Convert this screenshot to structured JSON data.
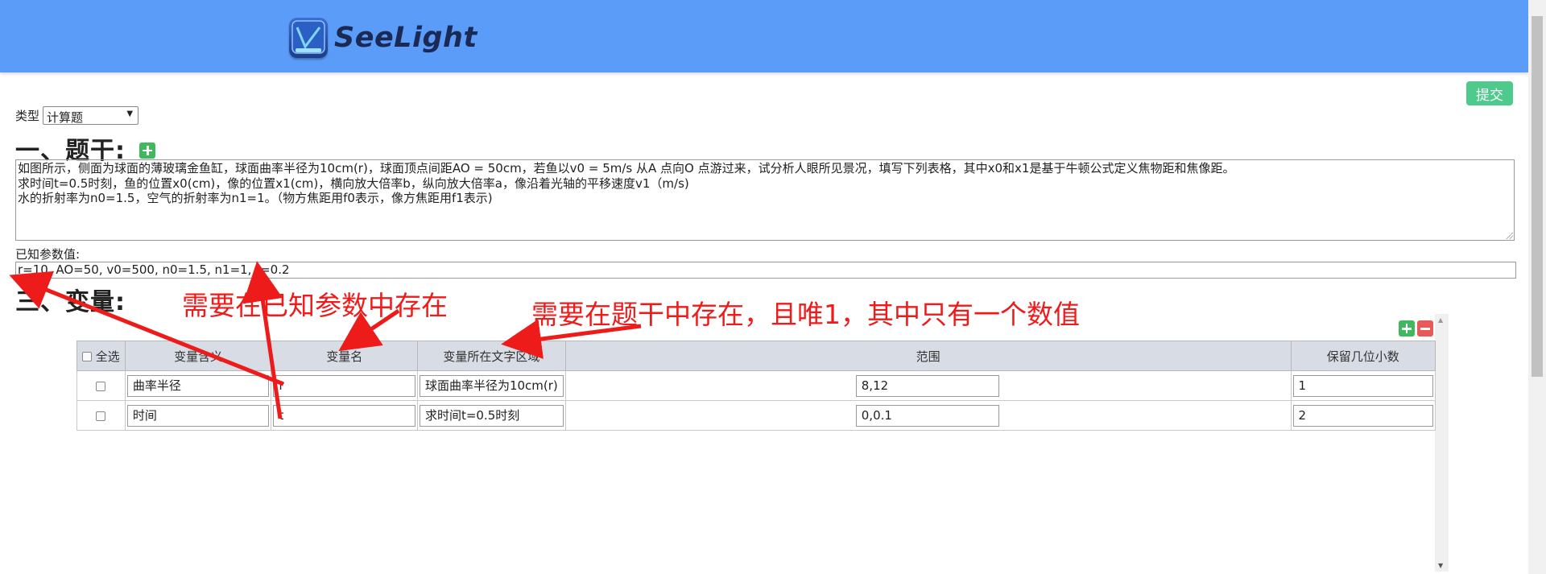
{
  "header": {
    "logo_text": "SeeLight",
    "logo_mark_text": "See Light"
  },
  "toolbar": {
    "submit_label": "提交"
  },
  "type_field": {
    "label": "类型",
    "value": "计算题"
  },
  "section_stem": {
    "title": "一、题干:"
  },
  "stem_text": [
    "如图所示，侧面为球面的薄玻璃金鱼缸，球面曲率半径为10cm(r)，球面顶点间距AO = 50cm，若鱼以v0 = 5m/s 从A 点向O 点游过来，试分析人眼所见景况，填写下列表格，其中x0和x1是基于牛顿公式定义焦物距和焦像距。",
    "求时间t=0.5时刻，鱼的位置x0(cm)，像的位置x1(cm)，横向放大倍率b，纵向放大倍率a，像沿着光轴的平移速度v1（m/s)",
    "水的折射率为n0=1.5，空气的折射率为n1=1。（物方焦距用f0表示，像方焦距用f1表示)"
  ],
  "known_params": {
    "label": "已知参数值:",
    "value": "r=10, AO=50, v0=500, n0=1.5, n1=1, t=0.2"
  },
  "section_vars": {
    "title": "三、变量:"
  },
  "annotations": {
    "known_note": "需要在已知参数中存在",
    "stem_note": "需要在题干中存在，且唯1，其中只有一个数值",
    "color": "#ee1b1b"
  },
  "var_table": {
    "select_all": "全选",
    "headers": [
      "变量含义",
      "变量名",
      "变量所在文字区域",
      "范围",
      "保留几位小数"
    ],
    "rows": [
      {
        "meaning": "曲率半径",
        "name": "r",
        "region": "球面曲率半径为10cm(r)",
        "range": "8,12",
        "decimals": "1"
      },
      {
        "meaning": "时间",
        "name": "t",
        "region": "求时间t=0.5时刻",
        "range": "0,0.1",
        "decimals": "2"
      }
    ]
  },
  "colors": {
    "header_bg": "#5b9cf9",
    "submit_bg": "#4ecb8c",
    "add_icon": "#3fb85e",
    "remove_icon": "#e85a5a"
  }
}
